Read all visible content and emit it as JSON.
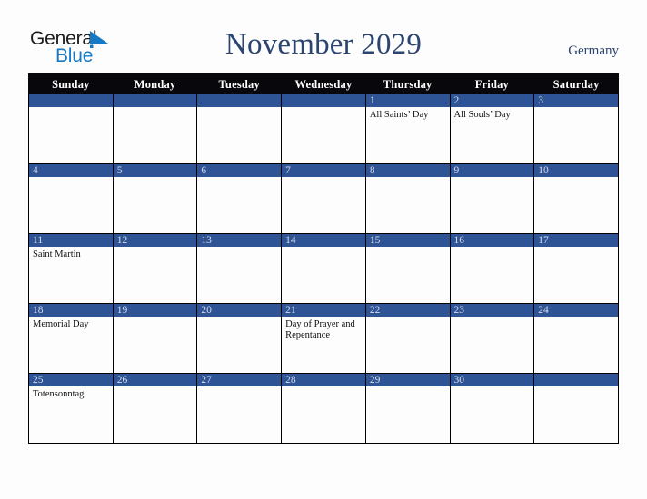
{
  "brand": {
    "name_part1": "General",
    "name_part2": "Blue",
    "mark_icon": "blue-triangle-logo-mark",
    "color_dark": "#1b1b1b",
    "color_blue": "#1679c4"
  },
  "header": {
    "title": "November 2029",
    "region": "Germany",
    "title_color": "#2b4570"
  },
  "calendar": {
    "accent_color": "#2f5496",
    "header_bg": "#08080c",
    "weekday_headers": [
      "Sunday",
      "Monday",
      "Tuesday",
      "Wednesday",
      "Thursday",
      "Friday",
      "Saturday"
    ],
    "weeks": [
      [
        {
          "day": "",
          "events": []
        },
        {
          "day": "",
          "events": []
        },
        {
          "day": "",
          "events": []
        },
        {
          "day": "",
          "events": []
        },
        {
          "day": "1",
          "events": [
            "All Saints’ Day"
          ]
        },
        {
          "day": "2",
          "events": [
            "All Souls’ Day"
          ]
        },
        {
          "day": "3",
          "events": []
        }
      ],
      [
        {
          "day": "4",
          "events": []
        },
        {
          "day": "5",
          "events": []
        },
        {
          "day": "6",
          "events": []
        },
        {
          "day": "7",
          "events": []
        },
        {
          "day": "8",
          "events": []
        },
        {
          "day": "9",
          "events": []
        },
        {
          "day": "10",
          "events": []
        }
      ],
      [
        {
          "day": "11",
          "events": [
            "Saint Martin"
          ]
        },
        {
          "day": "12",
          "events": []
        },
        {
          "day": "13",
          "events": []
        },
        {
          "day": "14",
          "events": []
        },
        {
          "day": "15",
          "events": []
        },
        {
          "day": "16",
          "events": []
        },
        {
          "day": "17",
          "events": []
        }
      ],
      [
        {
          "day": "18",
          "events": [
            "Memorial Day"
          ]
        },
        {
          "day": "19",
          "events": []
        },
        {
          "day": "20",
          "events": []
        },
        {
          "day": "21",
          "events": [
            "Day of Prayer and Repentance"
          ]
        },
        {
          "day": "22",
          "events": []
        },
        {
          "day": "23",
          "events": []
        },
        {
          "day": "24",
          "events": []
        }
      ],
      [
        {
          "day": "25",
          "events": [
            "Totensonntag"
          ]
        },
        {
          "day": "26",
          "events": []
        },
        {
          "day": "27",
          "events": []
        },
        {
          "day": "28",
          "events": []
        },
        {
          "day": "29",
          "events": []
        },
        {
          "day": "30",
          "events": []
        },
        {
          "day": "",
          "events": []
        }
      ]
    ]
  }
}
